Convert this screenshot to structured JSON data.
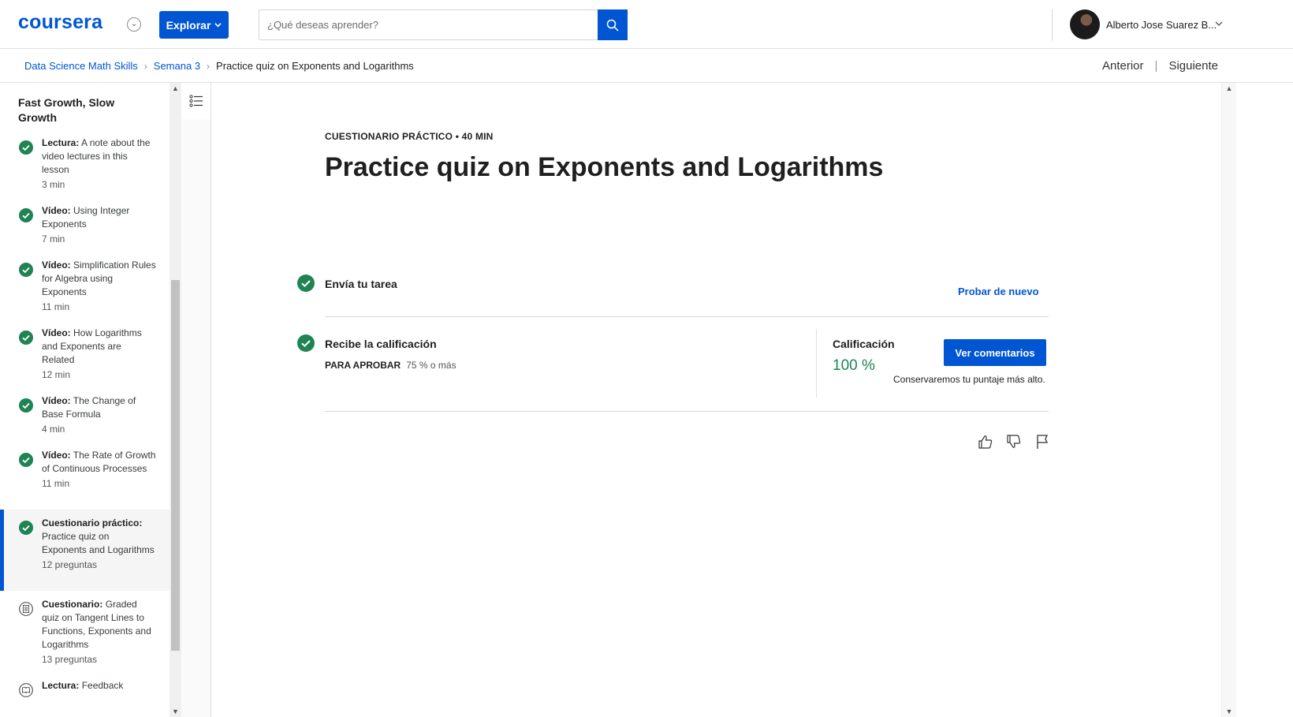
{
  "header": {
    "logo": "coursera",
    "explore_label": "Explorar",
    "search_placeholder": "¿Qué deseas aprender?",
    "user_name": "Alberto Jose Suarez B..."
  },
  "breadcrumb": {
    "items": [
      "Data Science Math Skills",
      "Semana 3"
    ],
    "current": "Practice quiz on Exponents and Logarithms"
  },
  "pager": {
    "prev": "Anterior",
    "separator": "|",
    "next": "Siguiente"
  },
  "sidebar": {
    "module_title": "Fast Growth, Slow Growth",
    "items": [
      {
        "type": "Lectura:",
        "title": "A note about the video lectures in this lesson",
        "meta": "3 min",
        "status": "completed"
      },
      {
        "type": "Vídeo:",
        "title": "Using Integer Exponents",
        "meta": "7 min",
        "status": "completed"
      },
      {
        "type": "Vídeo:",
        "title": "Simplification Rules for Algebra using Exponents",
        "meta": "11 min",
        "status": "completed"
      },
      {
        "type": "Vídeo:",
        "title": "How Logarithms and Exponents are Related",
        "meta": "12 min",
        "status": "completed"
      },
      {
        "type": "Vídeo:",
        "title": "The Change of Base Formula",
        "meta": "4 min",
        "status": "completed"
      },
      {
        "type": "Vídeo:",
        "title": "The Rate of Growth of Continuous Processes",
        "meta": "11 min",
        "status": "completed"
      },
      {
        "type": "Cuestionario práctico:",
        "title": "Practice quiz on Exponents and Logarithms",
        "meta": "12 preguntas",
        "status": "completed",
        "active": true
      },
      {
        "type": "Cuestionario:",
        "title": "Graded quiz on Tangent Lines to Functions, Exponents and Logarithms",
        "meta": "13 preguntas",
        "status": "quiz"
      },
      {
        "type": "Lectura:",
        "title": "Feedback",
        "meta": "",
        "status": "reading"
      }
    ]
  },
  "main": {
    "eyebrow": "CUESTIONARIO PRÁCTICO • 40 MIN",
    "title": "Practice quiz on Exponents and Logarithms",
    "step1_label": "Envía tu tarea",
    "retry_label": "Probar de nuevo",
    "step2_label": "Recibe la calificación",
    "pass_key": "PARA APROBAR",
    "pass_value": "75 % o más",
    "grade_label": "Calificación",
    "grade_value": "100 %",
    "feedback_button": "Ver comentarios",
    "keep_note": "Conservaremos tu puntaje más alto."
  },
  "colors": {
    "brand": "#0056d2",
    "success": "#1f8354"
  }
}
